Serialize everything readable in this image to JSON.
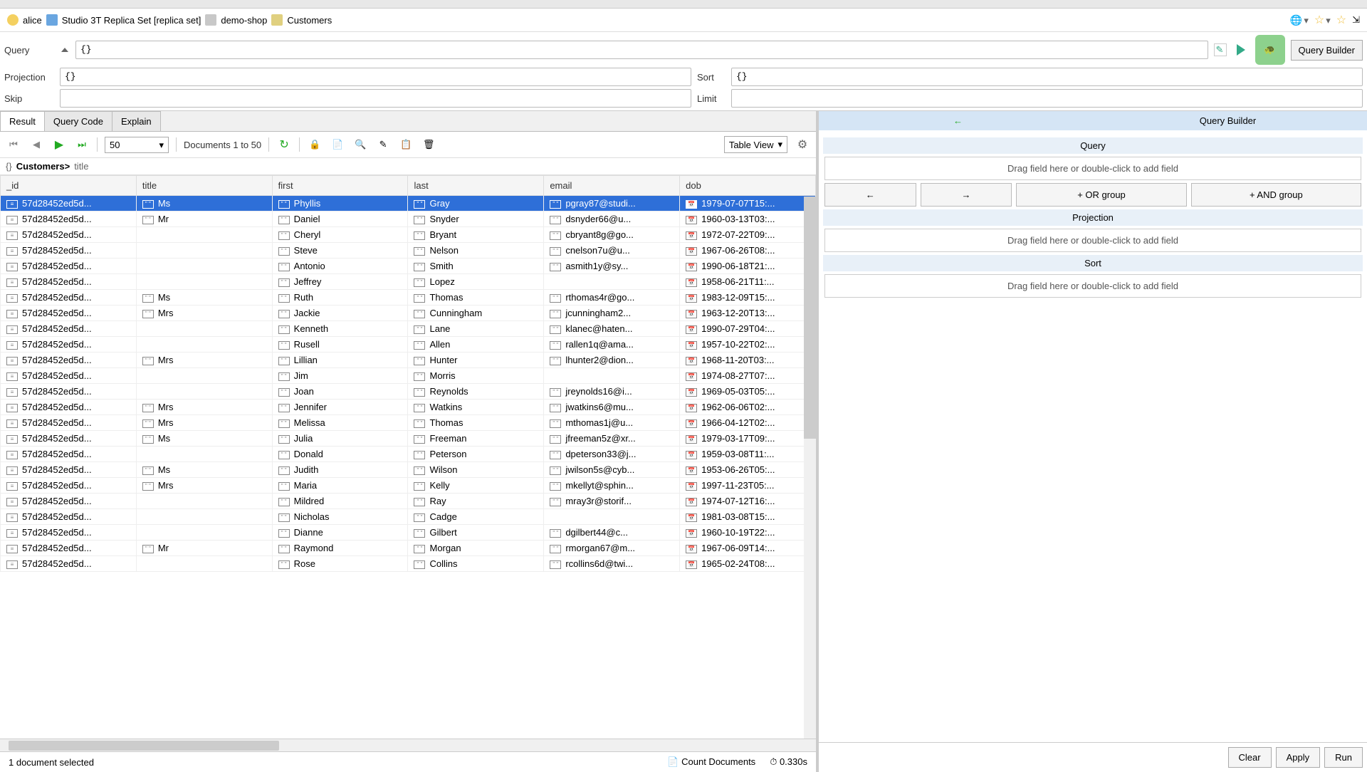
{
  "tab": {
    "name": "Customers"
  },
  "breadcrumb": {
    "user": "alice",
    "server": "Studio 3T Replica Set [replica set]",
    "database": "demo-shop",
    "collection": "Customers"
  },
  "query_builder_toggle": "Query Builder",
  "query": {
    "label": "Query",
    "value": "{}",
    "projection_label": "Projection",
    "projection_value": "{}",
    "sort_label": "Sort",
    "sort_value": "{}",
    "skip_label": "Skip",
    "skip_value": "",
    "limit_label": "Limit",
    "limit_value": ""
  },
  "result_tabs": {
    "result": "Result",
    "query_code": "Query Code",
    "explain": "Explain"
  },
  "pager": {
    "size": "50",
    "range": "Documents 1 to 50"
  },
  "view": {
    "mode": "Table View"
  },
  "path": {
    "collection": "Customers>",
    "field": "title"
  },
  "columns": [
    "_id",
    "title",
    "first",
    "last",
    "email",
    "dob"
  ],
  "rows": [
    {
      "id": "57d28452ed5d...",
      "title": "Ms",
      "first": "Phyllis",
      "last": "Gray",
      "email": "pgray87@studi...",
      "dob": "1979-07-07T15:...",
      "selected": true
    },
    {
      "id": "57d28452ed5d...",
      "title": "Mr",
      "first": "Daniel",
      "last": "Snyder",
      "email": "dsnyder66@u...",
      "dob": "1960-03-13T03:..."
    },
    {
      "id": "57d28452ed5d...",
      "title": "",
      "first": "Cheryl",
      "last": "Bryant",
      "email": "cbryant8g@go...",
      "dob": "1972-07-22T09:..."
    },
    {
      "id": "57d28452ed5d...",
      "title": "",
      "first": "Steve",
      "last": "Nelson",
      "email": "cnelson7u@u...",
      "dob": "1967-06-26T08:..."
    },
    {
      "id": "57d28452ed5d...",
      "title": "",
      "first": "Antonio",
      "last": "Smith",
      "email": "asmith1y@sy...",
      "dob": "1990-06-18T21:..."
    },
    {
      "id": "57d28452ed5d...",
      "title": "",
      "first": "Jeffrey",
      "last": "Lopez",
      "email": "",
      "dob": "1958-06-21T11:..."
    },
    {
      "id": "57d28452ed5d...",
      "title": "Ms",
      "first": "Ruth",
      "last": "Thomas",
      "email": "rthomas4r@go...",
      "dob": "1983-12-09T15:..."
    },
    {
      "id": "57d28452ed5d...",
      "title": "Mrs",
      "first": "Jackie",
      "last": "Cunningham",
      "email": "jcunningham2...",
      "dob": "1963-12-20T13:..."
    },
    {
      "id": "57d28452ed5d...",
      "title": "",
      "first": "Kenneth",
      "last": "Lane",
      "email": "klanec@haten...",
      "dob": "1990-07-29T04:..."
    },
    {
      "id": "57d28452ed5d...",
      "title": "",
      "first": "Rusell",
      "last": "Allen",
      "email": "rallen1q@ama...",
      "dob": "1957-10-22T02:..."
    },
    {
      "id": "57d28452ed5d...",
      "title": "Mrs",
      "first": "Lillian",
      "last": "Hunter",
      "email": "lhunter2@dion...",
      "dob": "1968-11-20T03:..."
    },
    {
      "id": "57d28452ed5d...",
      "title": "",
      "first": "Jim",
      "last": "Morris",
      "email": "",
      "dob": "1974-08-27T07:..."
    },
    {
      "id": "57d28452ed5d...",
      "title": "",
      "first": "Joan",
      "last": "Reynolds",
      "email": "jreynolds16@i...",
      "dob": "1969-05-03T05:..."
    },
    {
      "id": "57d28452ed5d...",
      "title": "Mrs",
      "first": "Jennifer",
      "last": "Watkins",
      "email": "jwatkins6@mu...",
      "dob": "1962-06-06T02:..."
    },
    {
      "id": "57d28452ed5d...",
      "title": "Mrs",
      "first": "Melissa",
      "last": "Thomas",
      "email": "mthomas1j@u...",
      "dob": "1966-04-12T02:..."
    },
    {
      "id": "57d28452ed5d...",
      "title": "Ms",
      "first": "Julia",
      "last": "Freeman",
      "email": "jfreeman5z@xr...",
      "dob": "1979-03-17T09:..."
    },
    {
      "id": "57d28452ed5d...",
      "title": "",
      "first": "Donald",
      "last": "Peterson",
      "email": "dpeterson33@j...",
      "dob": "1959-03-08T11:..."
    },
    {
      "id": "57d28452ed5d...",
      "title": "Ms",
      "first": "Judith",
      "last": "Wilson",
      "email": "jwilson5s@cyb...",
      "dob": "1953-06-26T05:..."
    },
    {
      "id": "57d28452ed5d...",
      "title": "Mrs",
      "first": "Maria",
      "last": "Kelly",
      "email": "mkellyt@sphin...",
      "dob": "1997-11-23T05:..."
    },
    {
      "id": "57d28452ed5d...",
      "title": "",
      "first": "Mildred",
      "last": "Ray",
      "email": "mray3r@storif...",
      "dob": "1974-07-12T16:..."
    },
    {
      "id": "57d28452ed5d...",
      "title": "",
      "first": "Nicholas",
      "last": "Cadge",
      "email": "",
      "dob": "1981-03-08T15:..."
    },
    {
      "id": "57d28452ed5d...",
      "title": "",
      "first": "Dianne",
      "last": "Gilbert",
      "email": "dgilbert44@c...",
      "dob": "1960-10-19T22:..."
    },
    {
      "id": "57d28452ed5d...",
      "title": "Mr",
      "first": "Raymond",
      "last": "Morgan",
      "email": "rmorgan67@m...",
      "dob": "1967-06-09T14:..."
    },
    {
      "id": "57d28452ed5d...",
      "title": "",
      "first": "Rose",
      "last": "Collins",
      "email": "rcollins6d@twi...",
      "dob": "1965-02-24T08:..."
    }
  ],
  "status": {
    "selected": "1 document selected",
    "count": "Count Documents",
    "time": "0.330s"
  },
  "qb": {
    "title": "Query Builder",
    "query_head": "Query",
    "drop_hint": "Drag field here or double-click to add field",
    "btn_back": "←",
    "btn_fwd": "→",
    "btn_or": "+ OR group",
    "btn_and": "+ AND group",
    "projection_head": "Projection",
    "sort_head": "Sort",
    "clear": "Clear",
    "apply": "Apply",
    "run": "Run"
  }
}
